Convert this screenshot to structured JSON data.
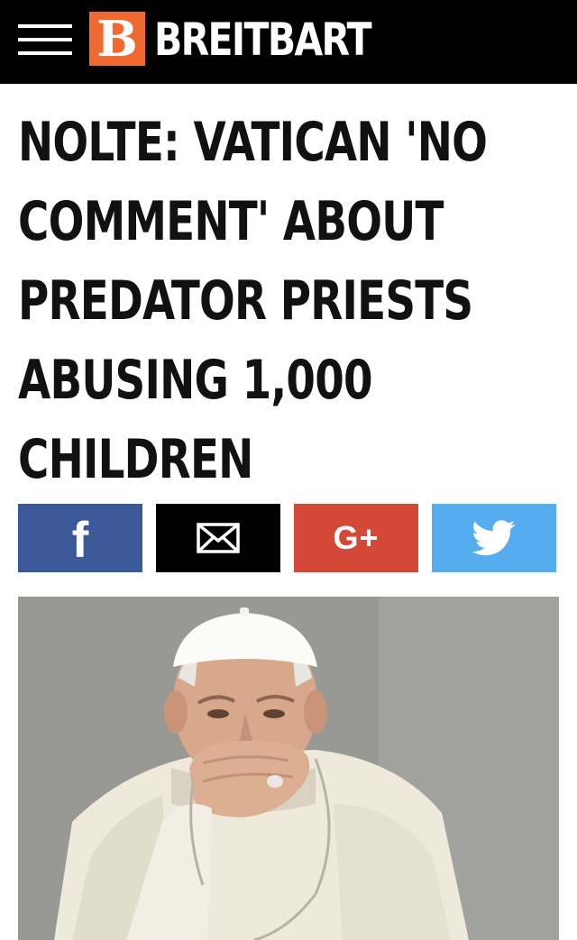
{
  "header": {
    "menu_icon": "hamburger-menu-icon",
    "logo_letter": "B",
    "logo_text": "BREITBART",
    "colors": {
      "background": "#000000",
      "logo_badge": "#ef6a30"
    }
  },
  "article": {
    "headline_lines": [
      "NOLTE: VATICAN 'NO",
      "COMMENT' ABOUT",
      "PREDATOR PRIESTS",
      "ABUSING 1,000",
      "CHILDREN"
    ]
  },
  "share": {
    "buttons": [
      {
        "icon": "facebook-icon",
        "glyph": "f",
        "color": "#3b5998"
      },
      {
        "icon": "email-icon",
        "color": "#000000"
      },
      {
        "icon": "google-plus-icon",
        "glyph": "G+",
        "color": "#d34836"
      },
      {
        "icon": "twitter-icon",
        "color": "#55acee"
      }
    ]
  },
  "photo": {
    "subject": "pope-portrait"
  }
}
